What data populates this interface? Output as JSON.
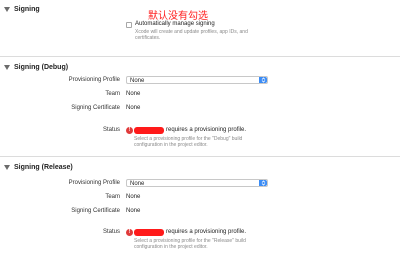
{
  "annotation": "默认没有勾选",
  "signing": {
    "title": "Signing",
    "auto_label": "Automatically manage signing",
    "auto_help_line1": "Xcode will create and update profiles, app IDs, and",
    "auto_help_line2": "certificates."
  },
  "debug": {
    "title": "Signing (Debug)",
    "profile_label": "Provisioning Profile",
    "profile_value": "None",
    "team_label": "Team",
    "team_value": "None",
    "cert_label": "Signing Certificate",
    "cert_value": "None",
    "status_label": "Status",
    "status_text": "requires a provisioning profile.",
    "status_help_line1": "Select a provisioning profile for the \"Debug\" build",
    "status_help_line2": "configuration in the project editor."
  },
  "release": {
    "title": "Signing (Release)",
    "profile_label": "Provisioning Profile",
    "profile_value": "None",
    "team_label": "Team",
    "team_value": "None",
    "cert_label": "Signing Certificate",
    "cert_value": "None",
    "status_label": "Status",
    "status_text": "requires a provisioning profile.",
    "status_help_line1": "Select a provisioning profile for the \"Release\" build",
    "status_help_line2": "configuration in the project editor."
  }
}
